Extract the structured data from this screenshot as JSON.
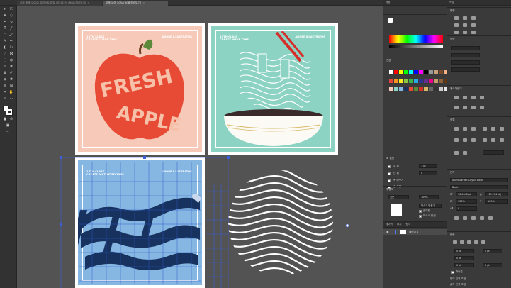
{
  "tabs": [
    {
      "label": "과제 예제 (2022) 일러스트 파일 (@ 132% (RGB/미리보기)",
      "active": false
    },
    {
      "label": "무제-1 @ 50% (RGB/미리보기)",
      "active": true
    }
  ],
  "artboards": [
    {
      "id": "fresh-apple",
      "caption": "15TH CLASS\nCREATE CURVE TYPE",
      "caption_right": "ADOBE ILLUSTRATOR",
      "bg": "#f6c9b9",
      "title_word_1": "FRESH",
      "title_word_2": "APPLE"
    },
    {
      "id": "noodle",
      "caption": "15TH CLASS\nCREATE WAVE TYPE",
      "caption_right": "ADOBE ILLUSTRATOR",
      "bg": "#8dd3c4"
    },
    {
      "id": "waves",
      "caption": "15TH CLASS\nCREATE DISTORTED TYPE",
      "caption_right": "ADOBE ILLUSTRATOR",
      "bg": "#86b7e2"
    },
    {
      "id": "circle",
      "bg": "#535353"
    }
  ],
  "mid_panel": {
    "tab_color": "색상",
    "tab_swatch": "견본",
    "section_stroke": "획 옵션",
    "stroke_rows": [
      {
        "label": "두 께",
        "value": "1 pt"
      },
      {
        "label": "단 위",
        "value": "0"
      },
      {
        "label": "사 용",
        "value": ""
      },
      {
        "label": "폭 바꾸기",
        "value": ""
      },
      {
        "label": "끝 모양",
        "value": ""
      }
    ],
    "section_transparency": "투명도",
    "transparency_mode": "표준",
    "transparency_value": "100%",
    "make_mask_label": "마스크 만들기",
    "clip_label": "클리핑",
    "invert_label": "마스크 반전",
    "layers_tabs": [
      "레이어",
      "대지",
      "링크"
    ],
    "layer_name": "레이어 1",
    "colors": {
      "swatch_row": [
        "#ffffff",
        "#ff0000",
        "#ffff00",
        "#00ff00",
        "#00ffff",
        "#0000ff",
        "#ff00ff",
        "#000000",
        "#999999",
        "#c8a27a",
        "#7a4b2a",
        "#f4b183"
      ]
    }
  },
  "right_panel": {
    "tab_properties": "속성",
    "tab_libraries": "라이브러리",
    "tab_layers": "레이어",
    "transform_label": "변형",
    "appearance_label": "모양",
    "pathfinder_label": "패스파인더",
    "align_label": "정렬",
    "char_label": "문자",
    "font_name": "AvantGardeITCbyBT Book",
    "font_style": "Book",
    "font_size": "16.0642 pt",
    "leading": "(19.274 pt)",
    "tracking": "100%",
    "kerning": "100%",
    "baseline": "0",
    "paragraph_label": "단락",
    "indent_values": [
      "0 pt",
      "0 pt",
      "0 pt"
    ],
    "space_values": [
      "0 pt",
      "0 pt"
    ],
    "hyphen_label": "하이픈",
    "bottom_label_1": "단어 간격 조정",
    "bottom_label_2": "글자 간격 조정"
  }
}
